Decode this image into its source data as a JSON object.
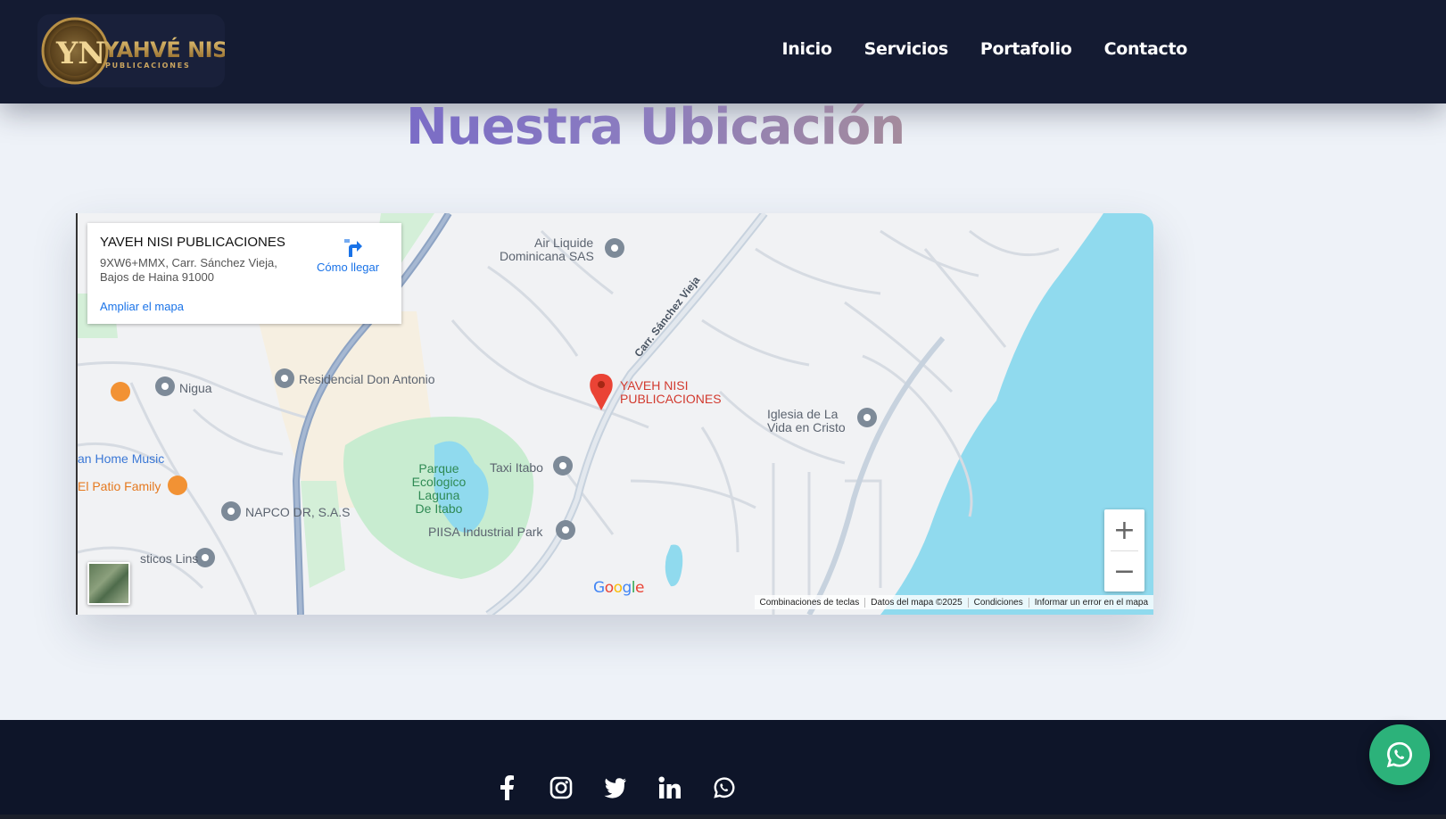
{
  "header": {
    "logo_text": "YAHVÉ NISI",
    "logo_subtext": "PUBLICACIONES",
    "logo_monogram": "YN",
    "nav": [
      {
        "label": "Inicio"
      },
      {
        "label": "Servicios"
      },
      {
        "label": "Portafolio"
      },
      {
        "label": "Contacto"
      }
    ]
  },
  "section": {
    "title": "Nuestra Ubicación"
  },
  "map": {
    "info": {
      "name": "YAVEH NISI PUBLICACIONES",
      "address": "9XW6+MMX, Carr. Sánchez Vieja, Bajos de Haina 91000",
      "directions_label": "Cómo llegar",
      "expand_label": "Ampliar el mapa"
    },
    "labels": {
      "air_liquide_1": "Air Liquide",
      "air_liquide_2": "Dominicana SAS",
      "road": "Carr. Sánchez Vieja",
      "marker_1": "YAVEH NISI",
      "marker_2": "PUBLICACIONES",
      "nigua": "Nigua",
      "residencial": "Residencial Don Antonio",
      "iglesia_1": "Iglesia de La",
      "iglesia_2": "Vida en Cristo",
      "home_music": "an Home Music",
      "patio": "El Patio Family",
      "taxi": "Taxi Itabo",
      "parque_1": "Parque",
      "parque_2": "Ecologico",
      "parque_3": "Laguna",
      "parque_4": "De Itabo",
      "napco": "NAPCO DR, S.A.S",
      "piisa": "PIISA Industrial Park",
      "lins": "sticos Lins"
    },
    "zoom_in": "+",
    "zoom_out": "−",
    "google": "Google",
    "attribution": {
      "shortcuts": "Combinaciones de teclas",
      "data": "Datos del mapa ©2025",
      "terms": "Condiciones",
      "report": "Informar un error en el mapa"
    }
  },
  "footer": {
    "socials": [
      "facebook-icon",
      "instagram-icon",
      "twitter-icon",
      "linkedin-icon",
      "whatsapp-icon"
    ]
  },
  "colors": {
    "header_bg": "#141b32",
    "footer_bg": "#0e1529",
    "page_bg": "#eef2f8",
    "water": "#90daee",
    "park": "#c8ecd0",
    "marker": "#ea4335",
    "whatsapp": "#2cb27a",
    "link": "#1a73e8"
  }
}
